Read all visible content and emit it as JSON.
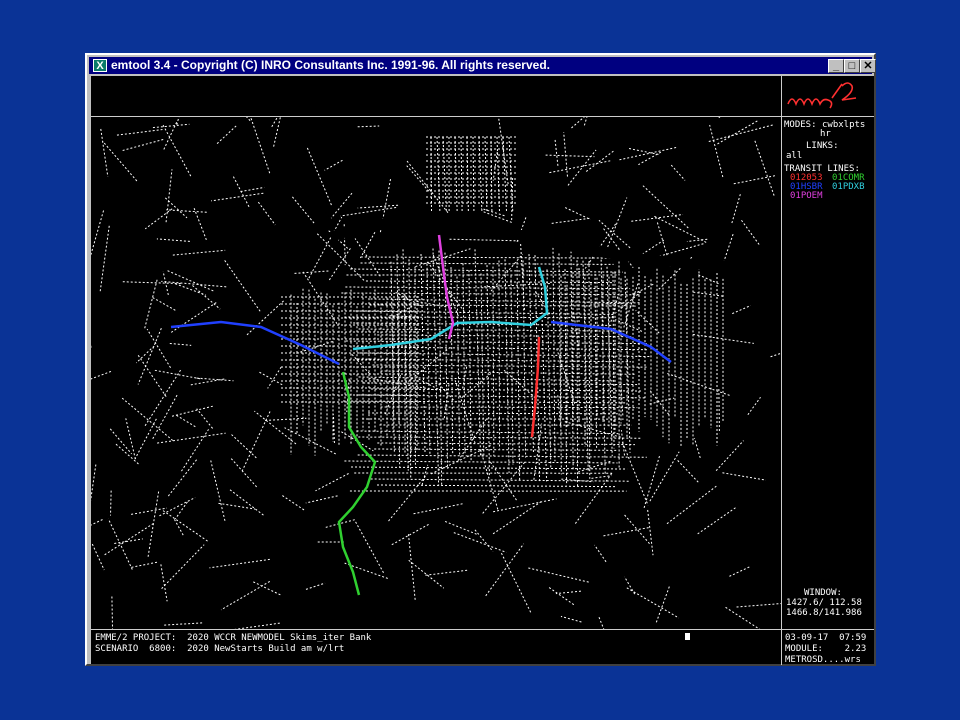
{
  "window": {
    "app_icon": "X",
    "title": "emtool 3.4 - Copyright (C) INRO Consultants Inc. 1991-96.  All rights reserved.",
    "minimize_label": "_",
    "maximize_label": "□",
    "close_label": "✕"
  },
  "logo": "emme/2",
  "side": {
    "modes_label": "MODES:",
    "modes_value": "cwbxlpts",
    "modes_value2": "hr",
    "links_label": "LINKS:",
    "links_value": "all",
    "transit_label": "TRANSIT LINES:",
    "transit_lines": [
      {
        "name": "012053",
        "color": "#ff3030"
      },
      {
        "name": "01COMR",
        "color": "#30d030"
      },
      {
        "name": "01HSBR",
        "color": "#2040ff"
      },
      {
        "name": "01PDXB",
        "color": "#30d0e0"
      },
      {
        "name": "01POEM",
        "color": "#e040e0"
      }
    ],
    "window_label": "WINDOW:",
    "window_line1": "1427.6/ 112.58",
    "window_line2": "1466.8/141.986"
  },
  "status": {
    "project_line": "EMME/2 PROJECT:  2020 WCCR NEWMODEL Skims_iter Bank",
    "scenario_line": "SCENARIO  6800:  2020 NewStarts Build am w/lrt",
    "date_time": "03-09-17  07:59",
    "module": "MODULE:    2.23",
    "user": "METROSD....wrs"
  },
  "colors": {
    "desktop": "#0a3396",
    "titlebar": "#000080",
    "network": "#ffffff"
  }
}
